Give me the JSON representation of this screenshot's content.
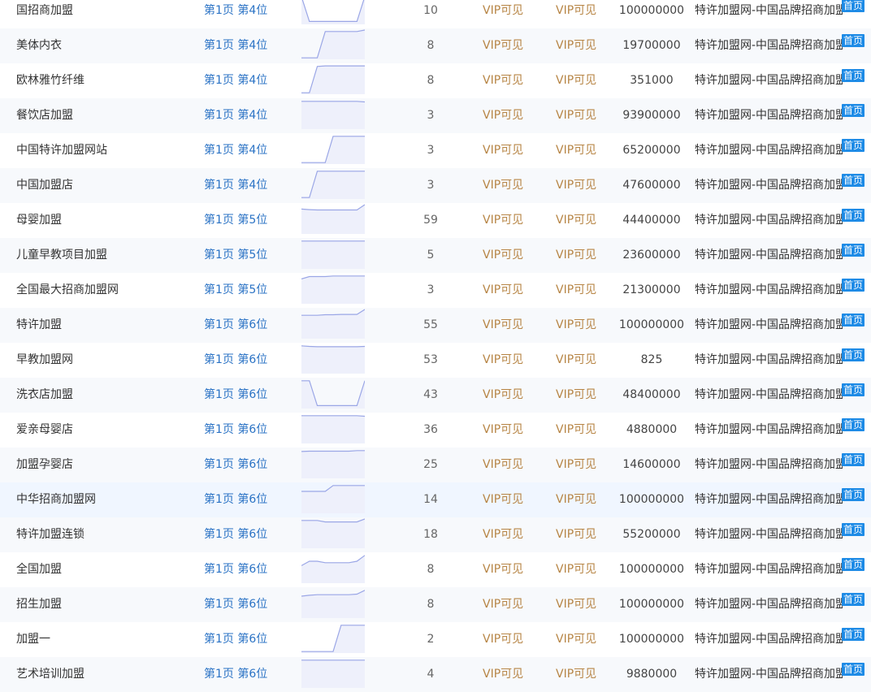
{
  "colors": {
    "link": "#2b73c5",
    "vip": "#b78545",
    "badge_bg": "#1e8be6",
    "sparkline_stroke": "#9aa6e6",
    "sparkline_fill": "#eef0fb"
  },
  "rows": [
    {
      "keyword": "国招商加盟",
      "rank": "第1页 第4位",
      "trend": [
        0.95,
        0.1,
        0.1,
        0.1,
        0.1,
        0.1,
        0.1,
        0.1,
        0.95
      ],
      "index": "10",
      "vip1": "VIP可见",
      "vip2": "VIP可见",
      "results": "100000000",
      "site": "特许加盟网-中国品牌招商加盟网",
      "badge": "首页"
    },
    {
      "keyword": "美体内衣",
      "rank": "第1页 第4位",
      "trend": [
        0.05,
        0.05,
        0.05,
        0.95,
        0.95,
        0.95,
        0.95,
        0.95,
        1.0
      ],
      "index": "8",
      "vip1": "VIP可见",
      "vip2": "VIP可见",
      "results": "19700000",
      "site": "特许加盟网-中国品牌招商加盟网",
      "badge": "首页"
    },
    {
      "keyword": "欧林雅竹纤维",
      "rank": "第1页 第4位",
      "trend": [
        0.05,
        0.05,
        0.95,
        0.97,
        0.97,
        0.97,
        0.97,
        0.97,
        0.97
      ],
      "index": "8",
      "vip1": "VIP可见",
      "vip2": "VIP可见",
      "results": "351000",
      "site": "特许加盟网-中国品牌招商加盟网",
      "badge": "首页"
    },
    {
      "keyword": "餐饮店加盟",
      "rank": "第1页 第4位",
      "trend": [
        0.95,
        0.95,
        0.95,
        0.95,
        0.95,
        0.95,
        0.95,
        0.95,
        0.93
      ],
      "index": "3",
      "vip1": "VIP可见",
      "vip2": "VIP可见",
      "results": "93900000",
      "site": "特许加盟网-中国品牌招商加盟网",
      "badge": "首页"
    },
    {
      "keyword": "中国特许加盟网站",
      "rank": "第1页 第4位",
      "trend": [
        0.05,
        0.05,
        0.05,
        0.05,
        0.95,
        0.95,
        0.95,
        0.95,
        0.95
      ],
      "index": "3",
      "vip1": "VIP可见",
      "vip2": "VIP可见",
      "results": "65200000",
      "site": "特许加盟网-中国品牌招商加盟网",
      "badge": "首页"
    },
    {
      "keyword": "中国加盟店",
      "rank": "第1页 第4位",
      "trend": [
        0.05,
        0.05,
        0.95,
        0.95,
        0.95,
        0.95,
        0.95,
        0.95,
        0.95
      ],
      "index": "3",
      "vip1": "VIP可见",
      "vip2": "VIP可见",
      "results": "47600000",
      "site": "特许加盟网-中国品牌招商加盟网",
      "badge": "首页"
    },
    {
      "keyword": "母婴加盟",
      "rank": "第1页 第5位",
      "trend": [
        0.85,
        0.83,
        0.82,
        0.82,
        0.82,
        0.82,
        0.82,
        0.82,
        1.0
      ],
      "index": "59",
      "vip1": "VIP可见",
      "vip2": "VIP可见",
      "results": "44400000",
      "site": "特许加盟网-中国品牌招商加盟网",
      "badge": "首页"
    },
    {
      "keyword": "儿童早教项目加盟",
      "rank": "第1页 第5位",
      "trend": [
        0.95,
        0.95,
        0.95,
        0.95,
        0.95,
        0.95,
        0.95,
        0.95,
        0.95
      ],
      "index": "5",
      "vip1": "VIP可见",
      "vip2": "VIP可见",
      "results": "23600000",
      "site": "特许加盟网-中国品牌招商加盟网",
      "badge": "首页"
    },
    {
      "keyword": "全国最大招商加盟网",
      "rank": "第1页 第5位",
      "trend": [
        0.85,
        0.93,
        0.93,
        0.93,
        0.95,
        0.95,
        0.95,
        0.95,
        0.95
      ],
      "index": "3",
      "vip1": "VIP可见",
      "vip2": "VIP可见",
      "results": "21300000",
      "site": "特许加盟网-中国品牌招商加盟网",
      "badge": "首页"
    },
    {
      "keyword": "特许加盟",
      "rank": "第1页 第6位",
      "trend": [
        0.8,
        0.8,
        0.8,
        0.82,
        0.82,
        0.83,
        0.83,
        0.83,
        1.0
      ],
      "index": "55",
      "vip1": "VIP可见",
      "vip2": "VIP可见",
      "results": "100000000",
      "site": "特许加盟网-中国品牌招商加盟网",
      "badge": "首页"
    },
    {
      "keyword": "早教加盟网",
      "rank": "第1页 第6位",
      "trend": [
        0.95,
        0.93,
        0.92,
        0.92,
        0.92,
        0.92,
        0.92,
        0.92,
        0.93
      ],
      "index": "53",
      "vip1": "VIP可见",
      "vip2": "VIP可见",
      "results": "825",
      "site": "特许加盟网-中国品牌招商加盟网",
      "badge": "首页"
    },
    {
      "keyword": "洗衣店加盟",
      "rank": "第1页 第6位",
      "trend": [
        0.95,
        0.95,
        0.1,
        0.1,
        0.1,
        0.1,
        0.1,
        0.1,
        0.95
      ],
      "index": "43",
      "vip1": "VIP可见",
      "vip2": "VIP可见",
      "results": "48400000",
      "site": "特许加盟网-中国品牌招商加盟网",
      "badge": "首页"
    },
    {
      "keyword": "爱亲母婴店",
      "rank": "第1页 第6位",
      "trend": [
        0.95,
        0.95,
        0.95,
        0.95,
        0.95,
        0.95,
        0.95,
        0.95,
        0.93
      ],
      "index": "36",
      "vip1": "VIP可见",
      "vip2": "VIP可见",
      "results": "4880000",
      "site": "特许加盟网-中国品牌招商加盟网",
      "badge": "首页"
    },
    {
      "keyword": "加盟孕婴店",
      "rank": "第1页 第6位",
      "trend": [
        0.92,
        0.93,
        0.93,
        0.93,
        0.93,
        0.93,
        0.93,
        0.95,
        0.95
      ],
      "index": "25",
      "vip1": "VIP可见",
      "vip2": "VIP可见",
      "results": "14600000",
      "site": "特许加盟网-中国品牌招商加盟网",
      "badge": "首页"
    },
    {
      "keyword": "中华招商加盟网",
      "rank": "第1页 第6位",
      "trend": [
        0.75,
        0.75,
        0.75,
        0.75,
        0.95,
        0.95,
        0.95,
        0.95,
        0.95
      ],
      "index": "14",
      "vip1": "VIP可见",
      "vip2": "VIP可见",
      "results": "100000000",
      "site": "特许加盟网-中国品牌招商加盟网",
      "badge": "首页"
    },
    {
      "keyword": "特许加盟连锁",
      "rank": "第1页 第6位",
      "trend": [
        0.95,
        0.95,
        0.95,
        0.9,
        0.9,
        0.9,
        0.9,
        0.9,
        1.0
      ],
      "index": "18",
      "vip1": "VIP可见",
      "vip2": "VIP可见",
      "results": "55200000",
      "site": "特许加盟网-中国品牌招商加盟网",
      "badge": "首页"
    },
    {
      "keyword": "全国加盟",
      "rank": "第1页 第6位",
      "trend": [
        0.6,
        0.75,
        0.75,
        0.7,
        0.7,
        0.7,
        0.7,
        0.75,
        0.95
      ],
      "index": "8",
      "vip1": "VIP可见",
      "vip2": "VIP可见",
      "results": "100000000",
      "site": "特许加盟网-中国品牌招商加盟网",
      "badge": "首页"
    },
    {
      "keyword": "招生加盟",
      "rank": "第1页 第6位",
      "trend": [
        0.75,
        0.78,
        0.8,
        0.8,
        0.8,
        0.8,
        0.8,
        0.82,
        0.95
      ],
      "index": "8",
      "vip1": "VIP可见",
      "vip2": "VIP可见",
      "results": "100000000",
      "site": "特许加盟网-中国品牌招商加盟网",
      "badge": "首页"
    },
    {
      "keyword": "加盟一",
      "rank": "第1页 第6位",
      "trend": [
        0.05,
        0.05,
        0.05,
        0.05,
        0.05,
        0.95,
        0.95,
        0.95,
        0.95
      ],
      "index": "2",
      "vip1": "VIP可见",
      "vip2": "VIP可见",
      "results": "100000000",
      "site": "特许加盟网-中国品牌招商加盟网",
      "badge": "首页"
    },
    {
      "keyword": "艺术培训加盟",
      "rank": "第1页 第6位",
      "trend": [
        0.95,
        0.95,
        0.95,
        0.95,
        0.95,
        0.95,
        0.95,
        0.95,
        0.95
      ],
      "index": "4",
      "vip1": "VIP可见",
      "vip2": "VIP可见",
      "results": "9880000",
      "site": "特许加盟网-中国品牌招商加盟网",
      "badge": "首页"
    }
  ]
}
